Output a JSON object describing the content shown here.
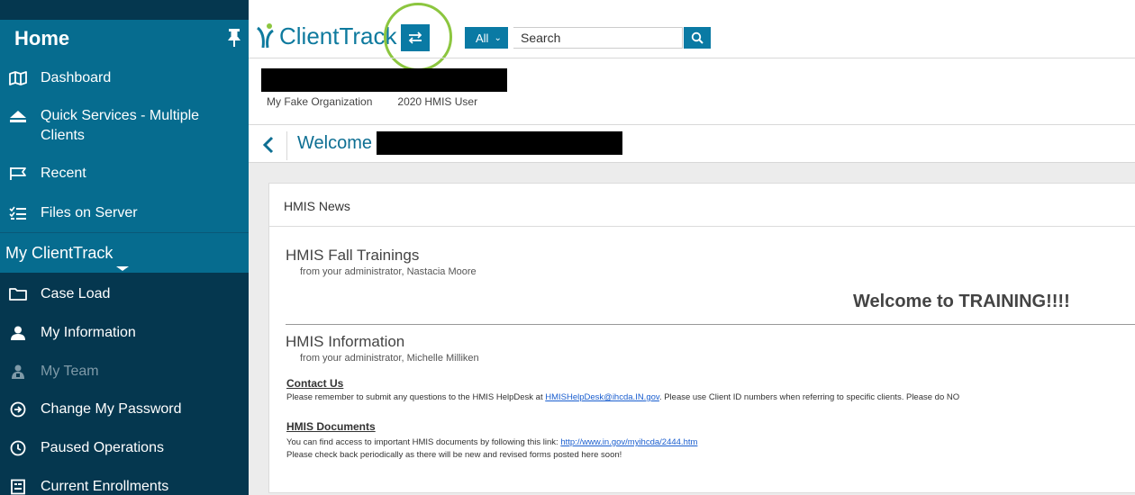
{
  "sidebar": {
    "title": "Home",
    "home_items": [
      {
        "label": "Dashboard"
      },
      {
        "label": "Quick Services - Multiple\nClients"
      },
      {
        "label": "Recent"
      },
      {
        "label": "Files on Server"
      }
    ],
    "section_title": "My ClientTrack",
    "section_items": [
      {
        "label": "Case Load"
      },
      {
        "label": "My Information"
      },
      {
        "label": "My Team",
        "disabled": true
      },
      {
        "label": "Change My Password"
      },
      {
        "label": "Paused Operations"
      },
      {
        "label": "Current Enrollments"
      }
    ]
  },
  "topbar": {
    "brand": "ClientTrack",
    "search_scope": "All",
    "search_placeholder": "Search"
  },
  "org": {
    "organization": "My Fake Organization",
    "user": "2020 HMIS User"
  },
  "page": {
    "welcome": "Welcome"
  },
  "news": {
    "panel_title": "HMIS News",
    "items": [
      {
        "title": "HMIS Fall Trainings",
        "from": "from your administrator, Nastacia Moore"
      },
      {
        "title": "HMIS Information",
        "from": "from your administrator, Michelle Milliken"
      }
    ],
    "banner": "Welcome to TRAINING!!!!",
    "contact": {
      "heading": "Contact Us",
      "text_before": "Please remember to submit any questions to the HMIS HelpDesk at ",
      "email": "HMISHelpDesk@ihcda.IN.gov",
      "text_after": ".  Please use Client ID numbers when referring to specific clients.  Please do NO"
    },
    "documents": {
      "heading": "HMIS Documents",
      "text_before": "You can find access to important HMIS documents by following this link:  ",
      "link": "http://www.in.gov/myihcda/2444.htm",
      "line2": "Please check back periodically as there will be new and revised forms posted here soon!"
    }
  },
  "colors": {
    "sidebar_dark": "#05374f",
    "sidebar_accent": "#066c8f",
    "brand_blue": "#0a7aa4",
    "highlight_green": "#8cc63f",
    "link_blue": "#1a5ecf"
  },
  "icons": {
    "pin": "pin-icon",
    "dashboard": "map-icon",
    "quick_services": "eject-icon",
    "recent": "flag-icon",
    "files": "list-check-icon",
    "case_load": "folder-icon",
    "my_information": "user-icon",
    "my_team": "team-icon",
    "change_password": "circle-arrow-right-icon",
    "paused": "clock-icon",
    "enrollments": "clipboard-icon",
    "switch": "swap-arrows-icon",
    "search": "search-icon",
    "back": "chevron-left-icon"
  }
}
